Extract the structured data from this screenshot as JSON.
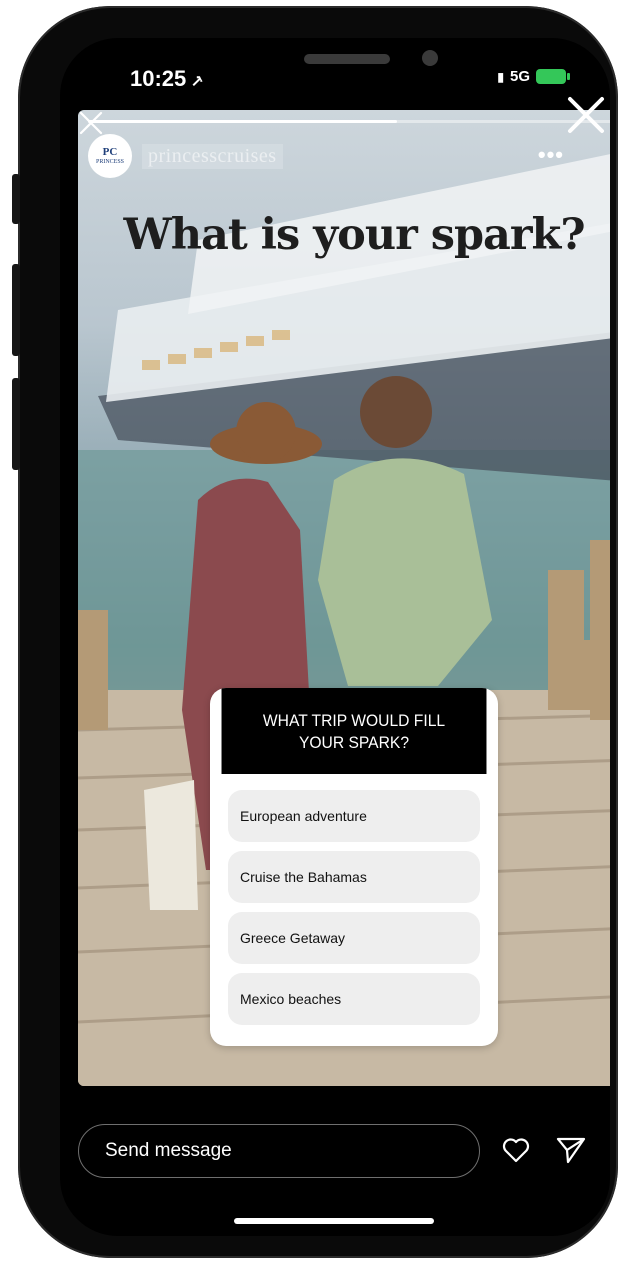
{
  "status_bar": {
    "time": "10:25",
    "network": "5G"
  },
  "story": {
    "account": {
      "avatar_text_top": "PC",
      "avatar_text_bottom": "PRINCESS",
      "username": "princesscruises"
    },
    "progress": 0.58,
    "headline": "What is your spark?",
    "poll": {
      "question": "WHAT TRIP WOULD FILL YOUR SPARK?",
      "options": [
        "European adventure",
        "Cruise the Bahamas",
        "Greece Getaway",
        "Mexico beaches"
      ]
    }
  },
  "bottom_bar": {
    "message_placeholder": "Send message"
  },
  "icons": {
    "close": "close-icon",
    "more": "more-icon",
    "heart": "heart-icon",
    "send": "send-icon"
  },
  "colors": {
    "poll_header": "#000000",
    "poll_option": "#eeeeee",
    "battery": "#34c759"
  }
}
